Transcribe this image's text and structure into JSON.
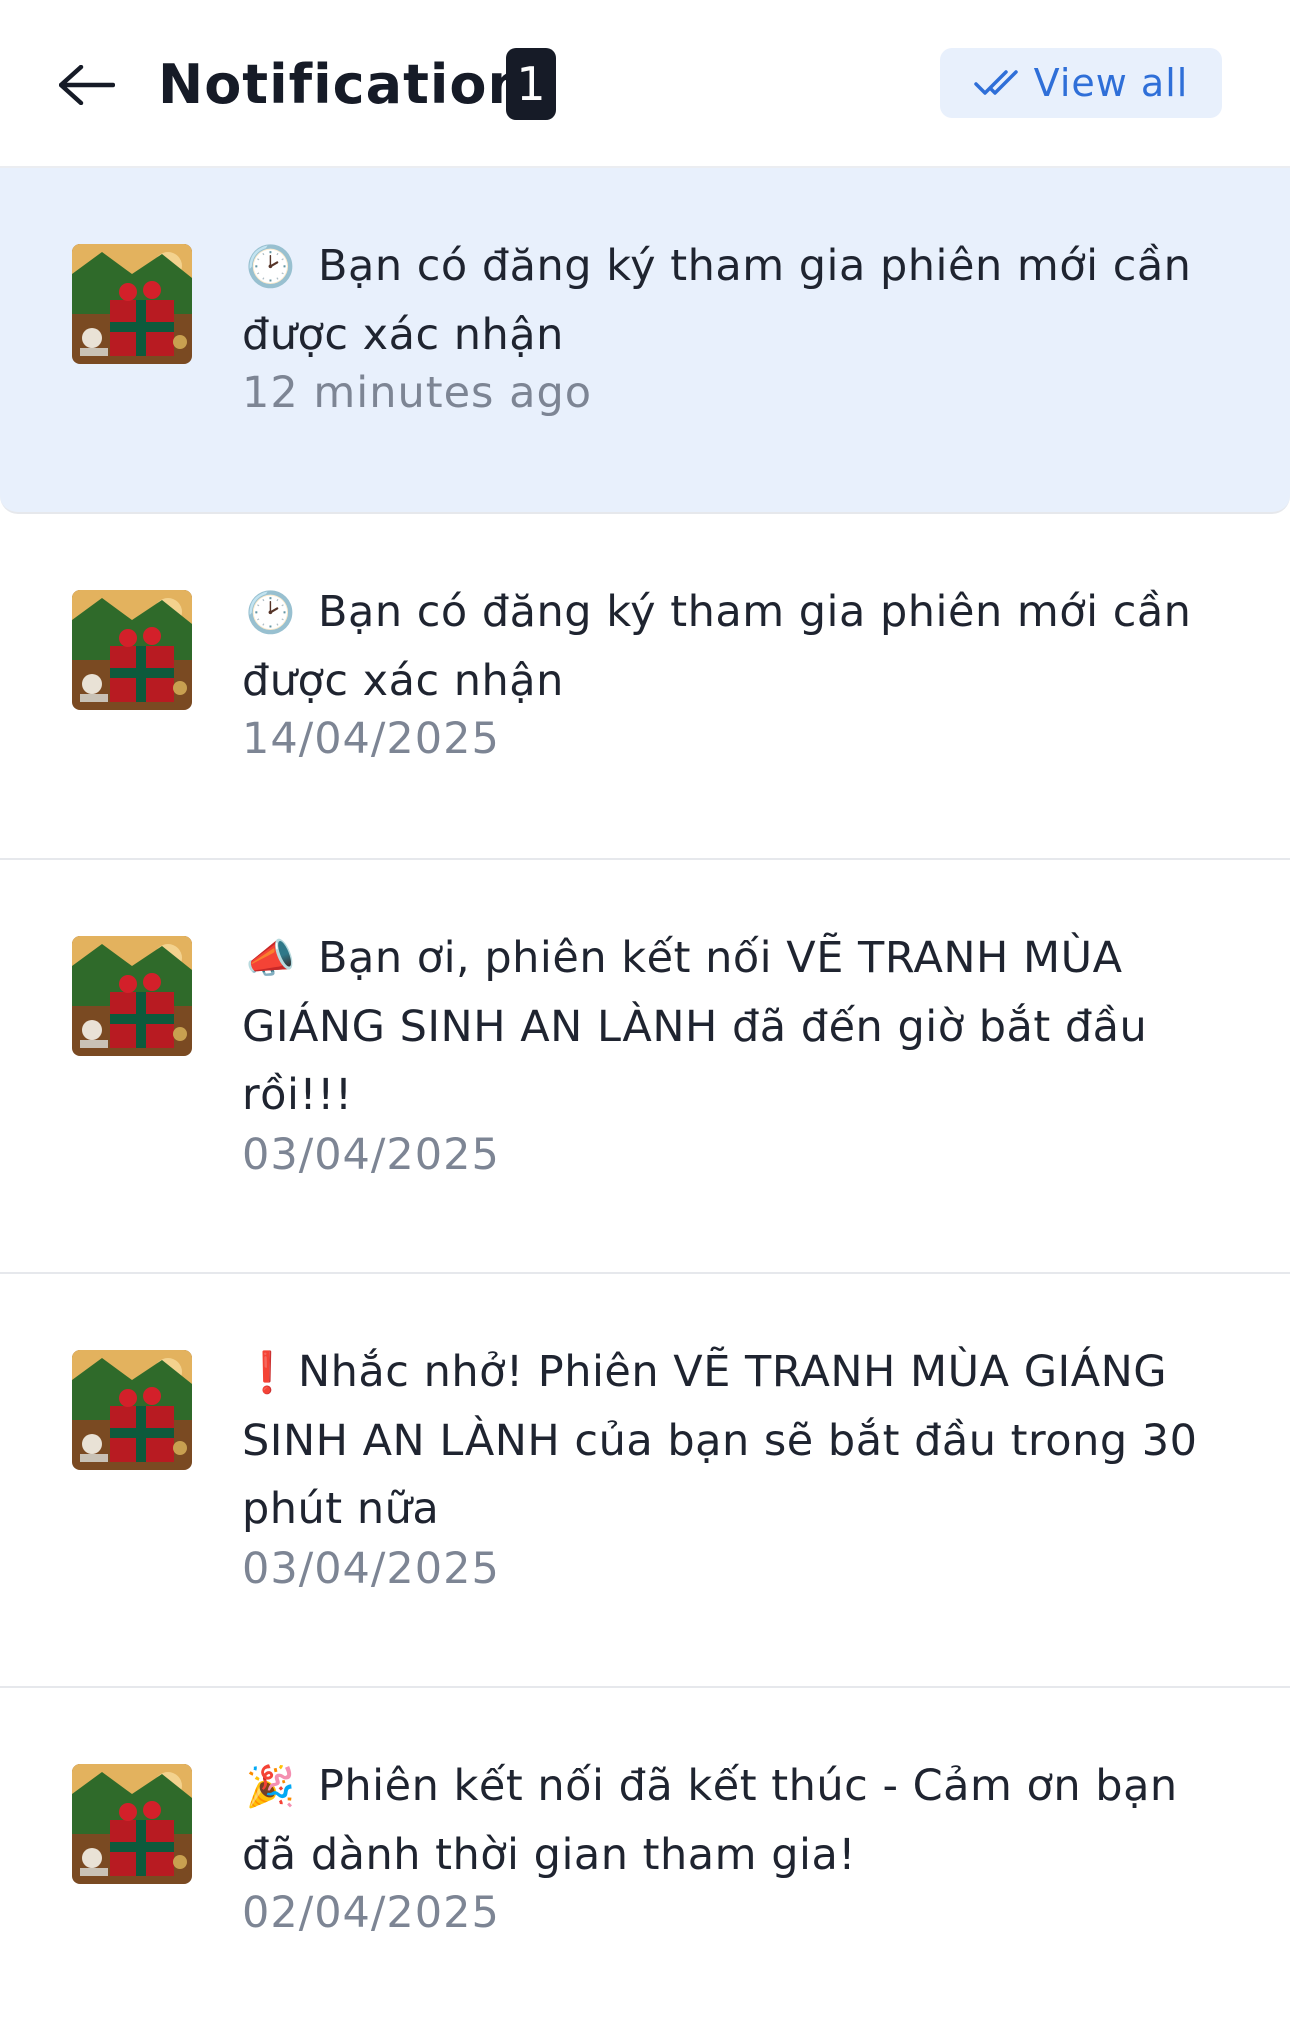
{
  "header": {
    "title": "Notification",
    "unread_count": "1",
    "view_all_label": "View all"
  },
  "notifications": [
    {
      "icon": "clock-icon",
      "emoji": "🕑",
      "message": "Bạn có đăng ký tham gia phiên mới cần được xác nhận",
      "time": "12 minutes ago",
      "unread": true
    },
    {
      "icon": "clock-icon",
      "emoji": "🕑",
      "message": "Bạn có đăng ký tham gia phiên mới cần được xác nhận",
      "time": "14/04/2025",
      "unread": false
    },
    {
      "icon": "megaphone-icon",
      "emoji": "📣",
      "message": "Bạn ơi, phiên kết nối VẼ TRANH MÙA GIÁNG SINH AN LÀNH đã đến giờ bắt đầu rồi!!!",
      "time": "03/04/2025",
      "unread": false
    },
    {
      "icon": "exclamation-icon",
      "emoji": "❗",
      "message": "Nhắc nhở! Phiên VẼ TRANH MÙA GIÁNG SINH AN LÀNH của bạn sẽ bắt đầu trong 30 phút nữa",
      "time": "03/04/2025",
      "unread": false
    },
    {
      "icon": "party-popper-icon",
      "emoji": "🎉",
      "message": "Phiên kết nối đã kết thúc - Cảm ơn bạn đã dành thời gian tham gia!",
      "time": "02/04/2025",
      "unread": false
    }
  ],
  "colors": {
    "unread_background": "#e8f0fc",
    "accent": "#2f6fd8",
    "title": "#161b27",
    "timestamp": "#7d8594"
  }
}
